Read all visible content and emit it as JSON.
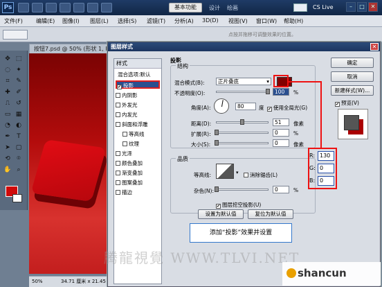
{
  "app": {
    "logo": "Ps",
    "workspace": "基本功能",
    "tabs": [
      "设计",
      "绘画"
    ],
    "cs_live": "CS Live",
    "min": "–",
    "max": "□",
    "close": "✕"
  },
  "menu": [
    "文件(F)",
    "编辑(E)",
    "图像(I)",
    "图层(L)",
    "选择(S)",
    "滤镜(T)",
    "分析(A)",
    "3D(D)",
    "视图(V)",
    "窗口(W)",
    "帮助(H)"
  ],
  "options": {
    "hint": "点按并拖移可调整效果的位置。"
  },
  "document": {
    "tab": "按钮7.psd @ 50% (形状 1, RGB/8)",
    "zoom": "50%",
    "info": "34.71 厘米 x 21.45 厘米 (72 ppi)"
  },
  "dialog": {
    "title": "图层样式",
    "close": "✕",
    "styles_header": "样式",
    "styles": [
      {
        "label": "混合选项:默认",
        "check": false,
        "plain": true
      },
      {
        "label": "投影",
        "check": true,
        "selected": true
      },
      {
        "label": "内阴影",
        "check": false
      },
      {
        "label": "外发光",
        "check": false
      },
      {
        "label": "内发光",
        "check": false
      },
      {
        "label": "斜面和浮雕",
        "check": false
      },
      {
        "label": "等高线",
        "check": false,
        "indent": true
      },
      {
        "label": "纹理",
        "check": false,
        "indent": true
      },
      {
        "label": "光泽",
        "check": false
      },
      {
        "label": "颜色叠加",
        "check": false
      },
      {
        "label": "渐变叠加",
        "check": false
      },
      {
        "label": "图案叠加",
        "check": false
      },
      {
        "label": "描边",
        "check": false
      }
    ],
    "section": "投影",
    "structure": "结构",
    "blend_mode_label": "混合模式(B):",
    "blend_mode": "正片叠底",
    "opacity_label": "不透明度(O):",
    "opacity": "100",
    "percent": "%",
    "angle_label": "角度(A):",
    "angle": "80",
    "degree": "度",
    "global_light": "使用全局光(G)",
    "distance_label": "距离(D):",
    "distance": "51",
    "spread_label": "扩展(R):",
    "spread": "0",
    "size_label": "大小(S):",
    "size": "0",
    "pixel": "像素",
    "quality": "品质",
    "contour_label": "等高线:",
    "antialias": "消除锯齿(L)",
    "noise_label": "杂色(N):",
    "noise": "0",
    "knockout": "图层挖空投影(U)",
    "set_default": "设置为默认值",
    "reset_default": "复位为默认值",
    "ok": "确定",
    "cancel": "取消",
    "new_style": "新建样式(W)...",
    "preview": "预览(V)",
    "shadow_color": "#820000"
  },
  "rgb": {
    "r_label": "R:",
    "r": "130",
    "g_label": "G:",
    "g": "0",
    "b_label": "B:",
    "b": "0"
  },
  "caption": "添加“投影”效果并设置",
  "watermark": "腾龍視覺 WWW.TLVI.NET",
  "site_logo": "shancun"
}
